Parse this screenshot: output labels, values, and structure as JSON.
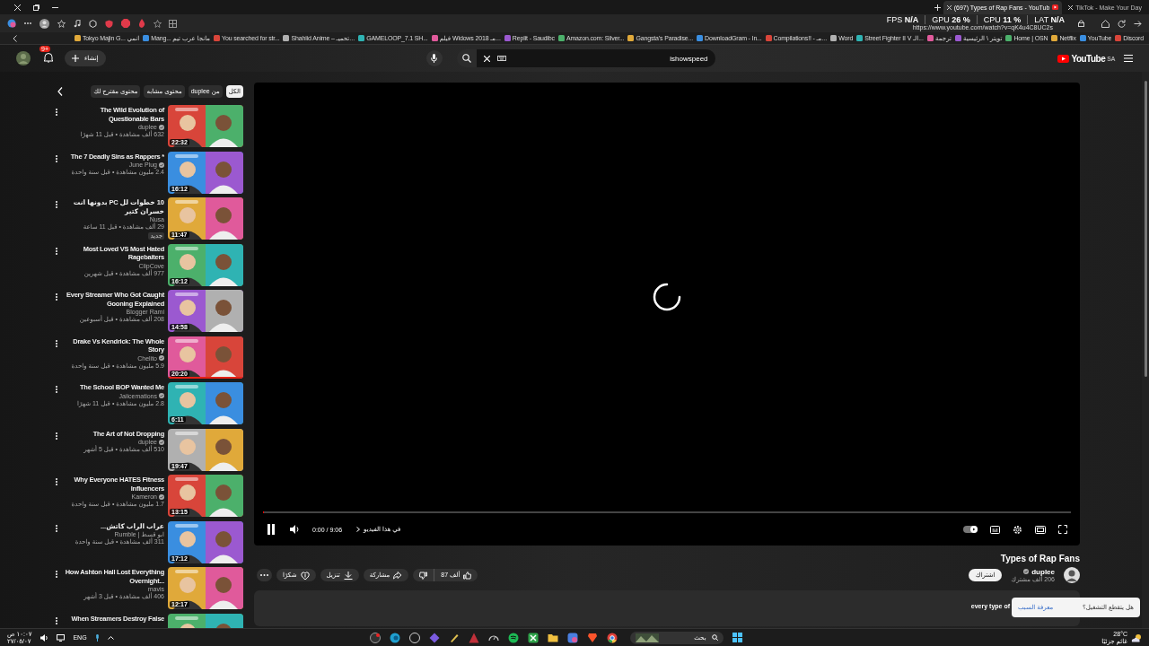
{
  "browser": {
    "tabs": [
      {
        "title": "TikTok - Make Your Day",
        "selected": false
      },
      {
        "title": "(697) Types of Rap Fans - YouTub",
        "selected": true
      }
    ],
    "stats": [
      "LAT **N/A**",
      "CPU **11 %**",
      "GPU **26 %**",
      "FPS **N/A**"
    ],
    "address": "https://www.youtube.com/watch?v=qK4u4C8UC2s",
    "bookmarks": [
      "Discord",
      "YouTube",
      "Netflix",
      "Home | OSN",
      "تويتر \\ الرئيسية",
      "ترجمة",
      "Street Fighter II V الـ...",
      "Word",
      "Compilations!! - مـ...",
      "DownloadGram - In...",
      "Gangsta's Paradise...",
      "Amazon.com: Silver...",
      "Replit - Saudibc",
      "فيلم Widows 2018 مـ...",
      "GAMELOOP_7.1 SH...",
      "Shahiid Anime – تحميـ...",
      "You searched for str...",
      "Mang... مانجا عرب تيم",
      "Tokyo Majin G... انمي"
    ]
  },
  "header": {
    "notifications": "9+",
    "create": "إنشاء",
    "search_value": "ishowspeed",
    "logo": "YouTube",
    "region": "SA"
  },
  "chips": [
    {
      "label": "الكل",
      "selected": true
    },
    {
      "label": "من duplee",
      "selected": false
    },
    {
      "label": "محتوى مشابه",
      "selected": false
    },
    {
      "label": "محتوى مقترح لك",
      "selected": false
    }
  ],
  "related": [
    {
      "title": "The Wild Evolution of Questionable Bars",
      "channel": "duplee",
      "verified": true,
      "meta": "632 ألف مشاهدة • قبل 11 شهرًا",
      "duration": "22:32"
    },
    {
      "title": "The 7 Deadly Sins as Rappers *",
      "channel": "June Plug",
      "verified": true,
      "meta": "2.4 مليون مشاهدة • قبل سنة واحدة",
      "duration": "16:12"
    },
    {
      "title": "10 خطوات لل PC بدونها انت خسران كتير",
      "channel": "Nusa",
      "verified": false,
      "meta": "29 ألف مشاهدة • قبل 11 ساعة",
      "badge": "جديد",
      "duration": "11:47"
    },
    {
      "title": "Most Loved VS Most Hated Ragebaiters",
      "channel": "ClipCove",
      "verified": false,
      "meta": "977 ألف مشاهدة • قبل شهرين",
      "duration": "16:12"
    },
    {
      "title": "Every Streamer Who Got Caught Gooning Explained",
      "channel": "Blogger Rami",
      "verified": false,
      "meta": "208 ألف مشاهدة • قبل أسبوعين",
      "duration": "14:58"
    },
    {
      "title": "Drake Vs Kendrick: The Whole Story",
      "channel": "Chelito",
      "verified": true,
      "meta": "5.9 مليون مشاهدة • قبل سنة واحدة",
      "duration": "20:20",
      "level": 1
    },
    {
      "title": "The School BOP Wanted Me",
      "channel": "Jaiicemations",
      "verified": true,
      "meta": "2.8 مليون مشاهدة • قبل 11 شهرًا",
      "duration": "6:11"
    },
    {
      "title": "The Art of Not Dropping",
      "channel": "duplee",
      "verified": true,
      "meta": "510 ألف مشاهدة • قبل 5 أشهر",
      "duration": "19:47"
    },
    {
      "title": "Why Everyone HATES Fitness Influencers",
      "channel": "Kameron",
      "verified": true,
      "meta": "1.7 مليون مشاهدة • قبل سنة واحدة",
      "duration": "13:15"
    },
    {
      "title": "عراب الراب كاتش...",
      "channel": "Rumble | ابو قسط",
      "verified": false,
      "meta": "311 ألف مشاهدة • قبل سنة واحدة",
      "duration": "17:12"
    },
    {
      "title": "How Ashton Hall Lost Everything Overnight...",
      "channel": "mavis",
      "verified": false,
      "meta": "406 ألف مشاهدة • قبل 3 أشهر",
      "duration": "12:17"
    },
    {
      "title": "When Streamers Destroy False"
    }
  ],
  "player": {
    "playing": true,
    "level": 0,
    "time": "0:00 / 9:06",
    "chapter": "في هذا الفيديو",
    "autoplay": true
  },
  "video": {
    "title": "Types of Rap Fans",
    "channel": "duplee",
    "verified": true,
    "subscribers": "206 ألف مشترك",
    "subscribe": "اشتراك",
    "likes": "87 ألف",
    "actions": [
      {
        "kind": "share",
        "label": "مشاركة"
      },
      {
        "kind": "download",
        "label": "تنزيل"
      },
      {
        "kind": "thanks",
        "label": "شكرًا"
      }
    ],
    "description": "every type of"
  },
  "popup": {
    "question": "هل يتقطع التشغيل؟",
    "link": "معرفة السبب"
  },
  "taskbar": {
    "time": "١٠:٠٧ ص",
    "date": "٢٧/٠٥/٠٧",
    "language": "ENG",
    "search": "بحث",
    "temperature": "28°C",
    "weather": "غائم جزئيًا"
  }
}
